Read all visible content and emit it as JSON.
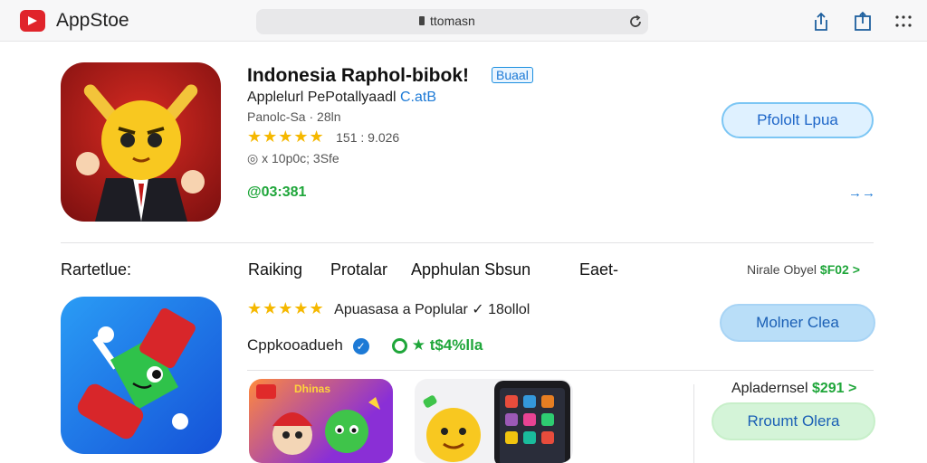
{
  "header": {
    "app_title": "AppStoe",
    "url": "ttomasn",
    "icons": [
      "share-icon",
      "share-box-icon",
      "grid-dots-icon"
    ]
  },
  "featured": {
    "title": "Indonesia Raphol‑bibok!",
    "badge": "Buaal",
    "subtitle_prefix": "Applelurl PePotallyaadl",
    "subtitle_link": "C.atB",
    "developer": "Panolc‑Sa  ·  28ln",
    "stars": "★★★★★",
    "rating": "151 : 9.026",
    "age": "◎ x 10p0c; 3Sfe",
    "downloads": "@03:381",
    "action": "Pfololt Lpua",
    "more": "→→"
  },
  "ranking": {
    "section_label": "Rartetlue:",
    "tabs": [
      "Raiking",
      "Protalar",
      "Apphulan Sbsun",
      "Eaet‑"
    ],
    "offer": "Nirale Obyel",
    "offer_price": "$F02 >",
    "stars": "★★★★★",
    "popular_line": "Apuasasa a Poplular  ✓ 18ollol",
    "developer": "Cppkooadueh",
    "count": "★ t$4%lla",
    "action": "Molner Clea",
    "applied": "Apladernsel",
    "applied_price": "$291 >",
    "action2": "Rroumt Olera",
    "promo_badge": "Dhinas"
  },
  "colors": {
    "accent": "#1e66c8",
    "star": "#f5b800",
    "green": "#1fa63a",
    "brand_red": "#e0242b"
  }
}
